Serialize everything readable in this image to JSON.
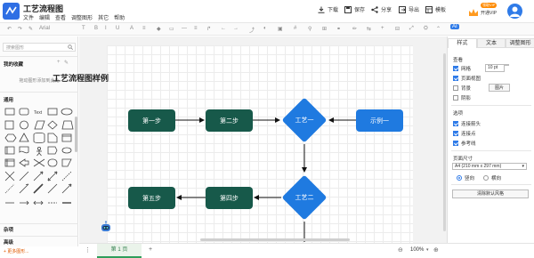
{
  "app": {
    "title": "工艺流程图"
  },
  "menu": [
    "文件",
    "编辑",
    "查看",
    "调整图形",
    "其它",
    "帮助"
  ],
  "toolbar": {
    "actions": [
      {
        "name": "download",
        "label": "下载"
      },
      {
        "name": "save",
        "label": "保存"
      },
      {
        "name": "share",
        "label": "分享"
      },
      {
        "name": "export",
        "label": "导出"
      },
      {
        "name": "template",
        "label": "模板"
      }
    ],
    "vip_badge": "领取VIP",
    "vip_label": "开通VIP",
    "font_name": "Arial"
  },
  "left_panel": {
    "search_placeholder": "搜索图形",
    "favorites_title": "我的收藏",
    "favorites_hint": "拖动图形添加到此处",
    "general_title": "通用",
    "misc_title": "杂项",
    "advanced_title": "高级",
    "more_shapes": "+ 更多图形..."
  },
  "diagram": {
    "title": "工艺流程图样例",
    "nodes": {
      "step1": "第一步",
      "step2": "第二步",
      "process1": "工艺一",
      "example1": "示例一",
      "process2": "工艺二",
      "step4": "第四步",
      "step5": "第五步"
    }
  },
  "right_panel": {
    "tabs": [
      "样式",
      "文本",
      "调整图形"
    ],
    "view_title": "查看",
    "grid_label": "网格",
    "grid_size": "10 pt",
    "page_view_label": "页面视图",
    "background_label": "背景",
    "image_button": "图片",
    "shadow_label": "阴影",
    "options_title": "选项",
    "connection_arrows_label": "连接箭头",
    "connection_points_label": "连接点",
    "guides_label": "参考线",
    "page_size_title": "页面尺寸",
    "page_size_value": "A4 (210 mm x 297 mm)",
    "portrait_label": "竖向",
    "landscape_label": "横向",
    "reset_button": "清除默认风格"
  },
  "bottom": {
    "page_tab": "第 1 页",
    "zoom": "100%"
  },
  "colors": {
    "node_green": "#17594a",
    "node_blue": "#1f7ae0",
    "accent": "#2f7be8"
  }
}
